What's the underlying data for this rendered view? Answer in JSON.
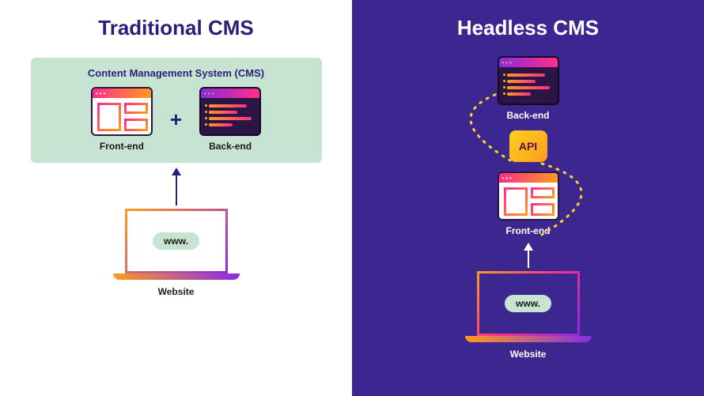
{
  "left": {
    "title": "Traditional CMS",
    "cms_box_title": "Content Management System (CMS)",
    "frontend_label": "Front-end",
    "backend_label": "Back-end",
    "plus": "+",
    "website_label": "Website",
    "www": "www."
  },
  "right": {
    "title": "Headless CMS",
    "backend_label": "Back-end",
    "api_label": "API",
    "frontend_label": "Front-end",
    "website_label": "Website",
    "www": "www."
  }
}
